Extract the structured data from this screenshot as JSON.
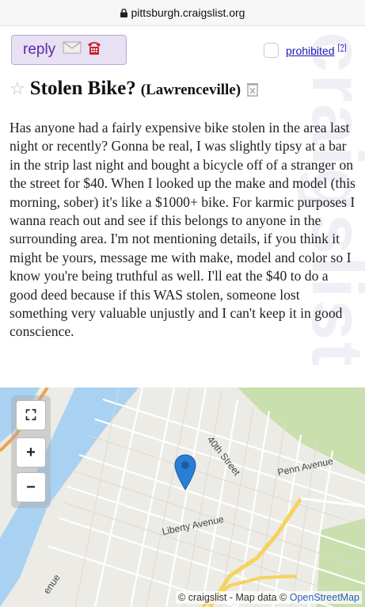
{
  "browser": {
    "url": "pittsburgh.craigslist.org"
  },
  "watermark": "craigslist",
  "actions": {
    "reply_label": "reply",
    "prohibited_label": "prohibited",
    "help_label": "[?]"
  },
  "post": {
    "title": "Stolen Bike?",
    "neighborhood": "(Lawrenceville)",
    "body": "Has anyone had a fairly expensive bike stolen in the area last night or recently? Gonna be real, I was slightly tipsy at a bar in the strip last night and bought a bicycle off of a stranger on the street for $40. When I looked up the make and model (this morning, sober) it's like a $1000+ bike. For karmic purposes I wanna reach out and see if this belongs to anyone in the surrounding area. I'm not mentioning details, if you think it might be yours, message me with make, model and color so I know you're being truthful as well. I'll eat the $40 to do a good deed because if this WAS stolen, someone lost something very valuable unjustly and I can't keep it in good conscience."
  },
  "map": {
    "controls": {
      "fullscreen": "⛶",
      "zoom_in": "+",
      "zoom_out": "−"
    },
    "street_labels": {
      "fortieth": "40th Street",
      "penn": "Penn Avenue",
      "liberty": "Liberty Avenue",
      "bottom_left": "enue"
    },
    "attribution": {
      "prefix": "© craigslist - Map data ©",
      "link": "OpenStreetMap"
    }
  },
  "colors": {
    "accent": "#5b2aa8",
    "link": "#1f15b6",
    "river": "#a9d2f2",
    "park": "#c9dfae",
    "highway": "#f4d35e"
  }
}
